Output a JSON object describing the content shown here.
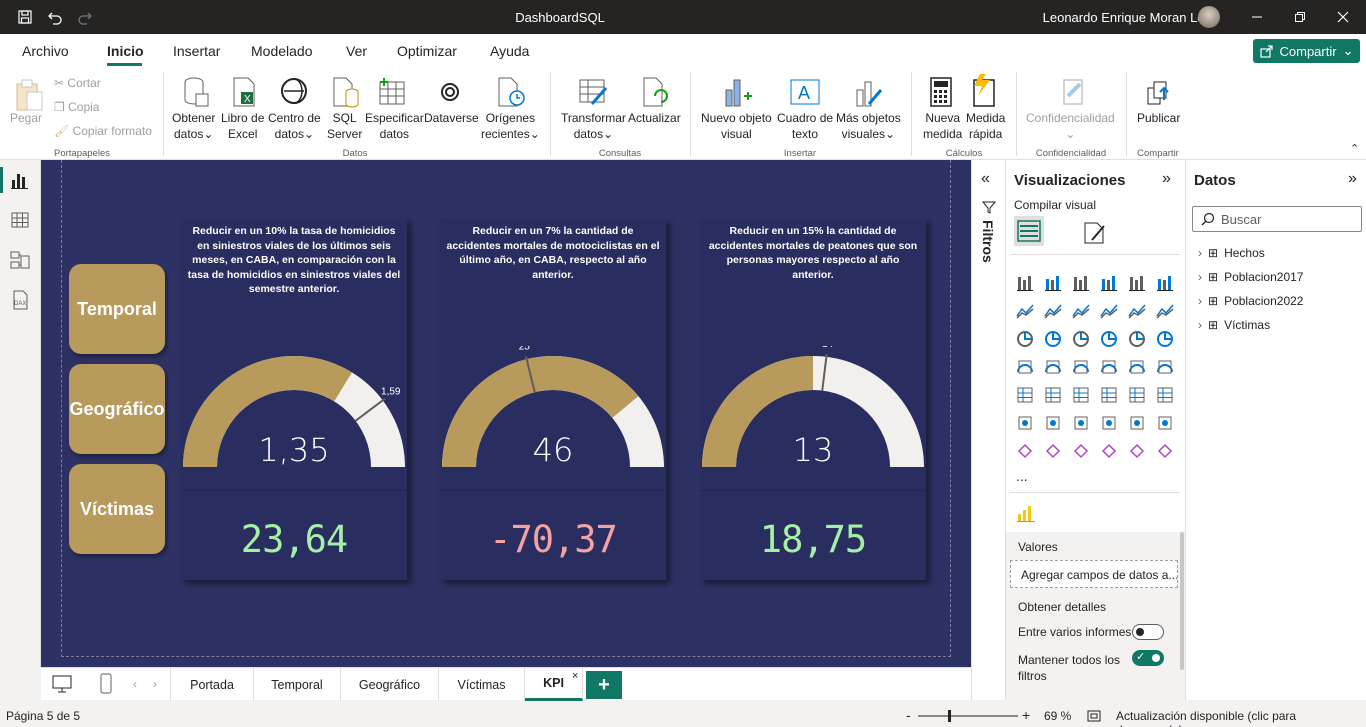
{
  "window": {
    "title": "DashboardSQL",
    "user": "Leonardo Enrique Moran Leon"
  },
  "menu": [
    "Archivo",
    "Inicio",
    "Insertar",
    "Modelado",
    "Ver",
    "Optimizar",
    "Ayuda"
  ],
  "share_label": "Compartir",
  "ribbon": {
    "pegar": "Pegar",
    "cortar": "Cortar",
    "copia": "Copia",
    "copiar_formato": "Copiar formato",
    "obtener_datos": [
      "Obtener",
      "datos"
    ],
    "libro_excel": [
      "Libro de",
      "Excel"
    ],
    "centro_datos": [
      "Centro de",
      "datos"
    ],
    "sql_server": [
      "SQL",
      "Server"
    ],
    "especificar": [
      "Especificar",
      "datos"
    ],
    "dataverse": "Dataverse",
    "origenes": [
      "Orígenes",
      "recientes"
    ],
    "transformar": [
      "Transformar",
      "datos"
    ],
    "actualizar": "Actualizar",
    "nuevo_objeto": [
      "Nuevo objeto",
      "visual"
    ],
    "cuadro_texto": [
      "Cuadro de",
      "texto"
    ],
    "mas_objetos": [
      "Más objetos",
      "visuales"
    ],
    "nueva_medida": [
      "Nueva",
      "medida"
    ],
    "medida_rapida": [
      "Medida",
      "rápida"
    ],
    "confidencialidad": "Confidencialidad",
    "publicar": "Publicar",
    "groups": {
      "portapapeles": "Portapapeles",
      "datos": "Datos",
      "consultas": "Consultas",
      "insertar": "Insertar",
      "calculos": "Cálculos",
      "confidencialidad": "Confidencialidad",
      "compartir": "Compartir"
    }
  },
  "nav_buttons": [
    "Temporal",
    "Geográfico",
    "Víctimas"
  ],
  "cards": [
    {
      "title": "Reducir en un 10% la tasa de homicidios en siniestros viales de los últimos seis meses, en CABA, en comparación con la tasa de homicidios en siniestros viales del semestre anterior.",
      "value": 1.35,
      "value_label": "1,35",
      "target": 1.59,
      "target_label": "1,59",
      "max": 2.0,
      "kpi": "23,64",
      "kpi_color": "#a6f0a6"
    },
    {
      "title": "Reducir en un 7% la cantidad de accidentes mortales de motociclistas en el último año, en CABA, respecto al año anterior.",
      "value": 46,
      "value_label": "46",
      "target": 25,
      "target_label": "25",
      "max": 59,
      "kpi": "-70,37",
      "kpi_color": "#f4a3a3"
    },
    {
      "title": "Reducir en un 15% la cantidad de accidentes mortales de peatones que son personas mayores respecto al año anterior.",
      "value": 13,
      "value_label": "13",
      "target": 14,
      "target_label": "14",
      "max": 26,
      "kpi": "18,75",
      "kpi_color": "#a6f0a6"
    }
  ],
  "filters_label": "Filtros",
  "viz": {
    "title": "Visualizaciones",
    "build": "Compilar visual",
    "values_label": "Valores",
    "add_fields": "Agregar campos de datos a...",
    "drill": "Obtener detalles",
    "cross_report": "Entre varios informes",
    "keep_filters": "Mantener todos los filtros",
    "more": "..."
  },
  "data_pane": {
    "title": "Datos",
    "search_placeholder": "Buscar",
    "tables": [
      "Hechos",
      "Poblacion2017",
      "Poblacion2022",
      "Víctimas"
    ]
  },
  "page_tabs": [
    "Portada",
    "Temporal",
    "Geográfico",
    "Víctimas",
    "KPI"
  ],
  "status": {
    "page": "Página 5 de 5",
    "zoom": "69 %",
    "update": "Actualización disponible (clic para descargarla)"
  },
  "colors": {
    "gold": "#b79a5c",
    "navy": "#2e3163",
    "card": "#2a2d60",
    "teal": "#117865",
    "gauge_bg": "#f2f0ee"
  }
}
